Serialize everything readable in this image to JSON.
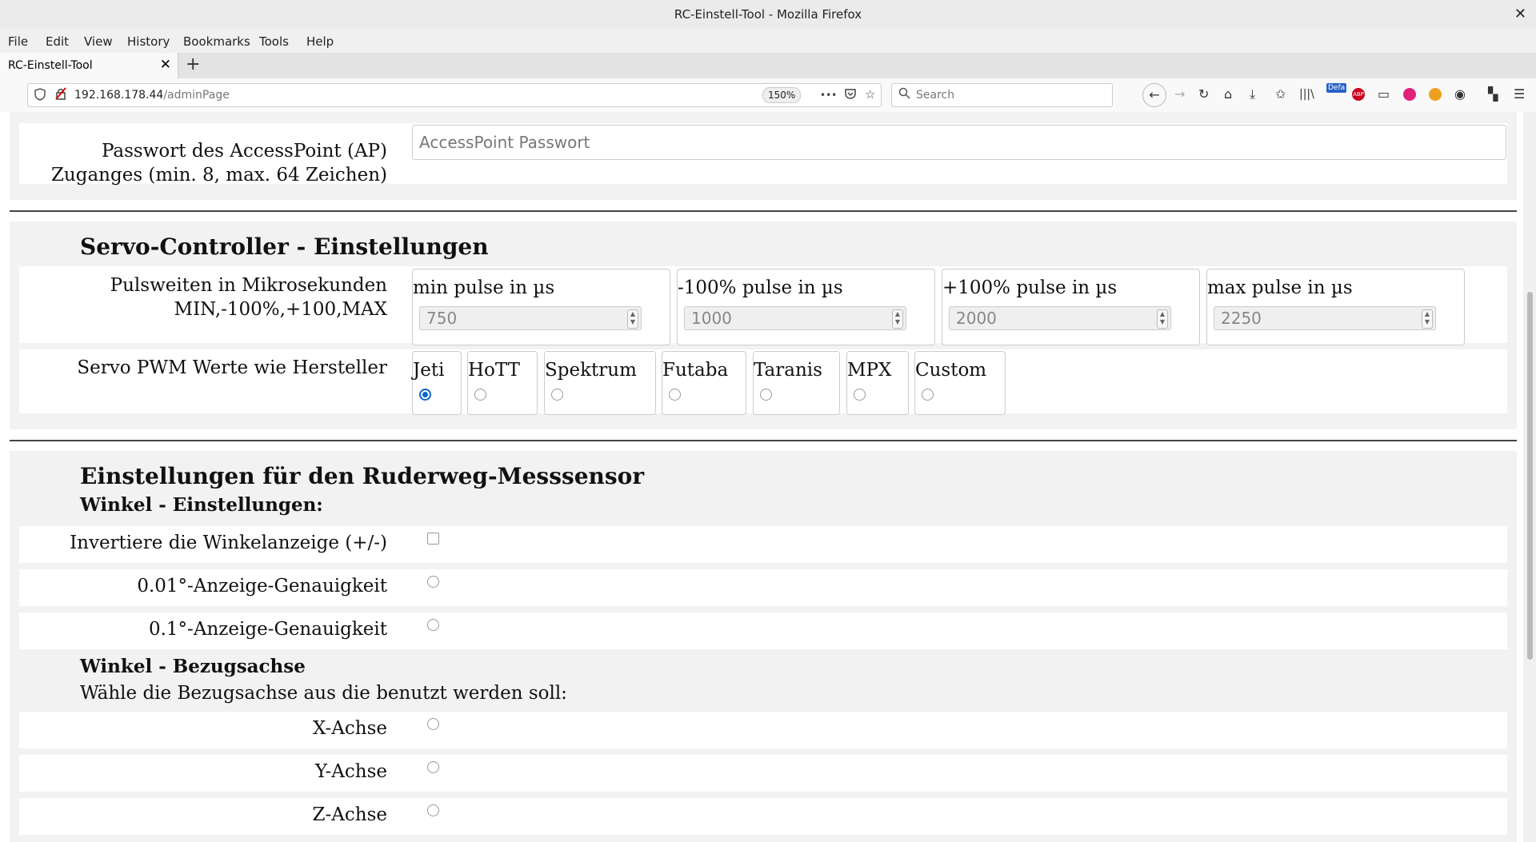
{
  "window": {
    "title": "RC-Einstell-Tool - Mozilla Firefox",
    "close_glyph": "✕"
  },
  "menu": [
    "File",
    "Edit",
    "View",
    "History",
    "Bookmarks",
    "Tools",
    "Help"
  ],
  "tab": {
    "title": "RC-Einstell-Tool",
    "close_glyph": "✕",
    "new_glyph": "+"
  },
  "address": {
    "host": "192.168.178.44",
    "path": "/adminPage",
    "zoom": "150%",
    "more_glyph": "•••"
  },
  "search": {
    "placeholder": "Search"
  },
  "toolbar_badge": "Defa",
  "ap": {
    "label_line1": "Passwort des AccessPoint (AP)",
    "label_line2": "Zuganges (min. 8, max. 64 Zeichen)",
    "placeholder": "AccessPoint Passwort"
  },
  "servo": {
    "heading": "Servo-Controller - Einstellungen",
    "pulse_label_line1": "Pulsweiten in Mikrosekunden",
    "pulse_label_line2": "MIN,-100%,+100,MAX",
    "pulses": [
      {
        "caption": "min pulse in µs",
        "value": "750"
      },
      {
        "caption": "-100% pulse in µs",
        "value": "1000"
      },
      {
        "caption": "+100% pulse in µs",
        "value": "2000"
      },
      {
        "caption": "max pulse in µs",
        "value": "2250"
      }
    ],
    "pwm_label": "Servo PWM Werte wie Hersteller",
    "manufacturers": [
      "Jeti",
      "HoTT",
      "Spektrum",
      "Futaba",
      "Taranis",
      "MPX",
      "Custom"
    ],
    "selected_manufacturer": "Jeti"
  },
  "sensor": {
    "heading": "Einstellungen für den Ruderweg-Messsensor",
    "angle_heading": "Winkel - Einstellungen:",
    "invert_label": "Invertiere die Winkelanzeige (+/-)",
    "precision_001_label": "0.01°-Anzeige-Genauigkeit",
    "precision_01_label": "0.1°-Anzeige-Genauigkeit",
    "axis_heading": "Winkel - Bezugsachse",
    "axis_text": "Wähle die Bezugsachse aus die benutzt werden soll:",
    "axes": [
      "X-Achse",
      "Y-Achse",
      "Z-Achse"
    ]
  }
}
